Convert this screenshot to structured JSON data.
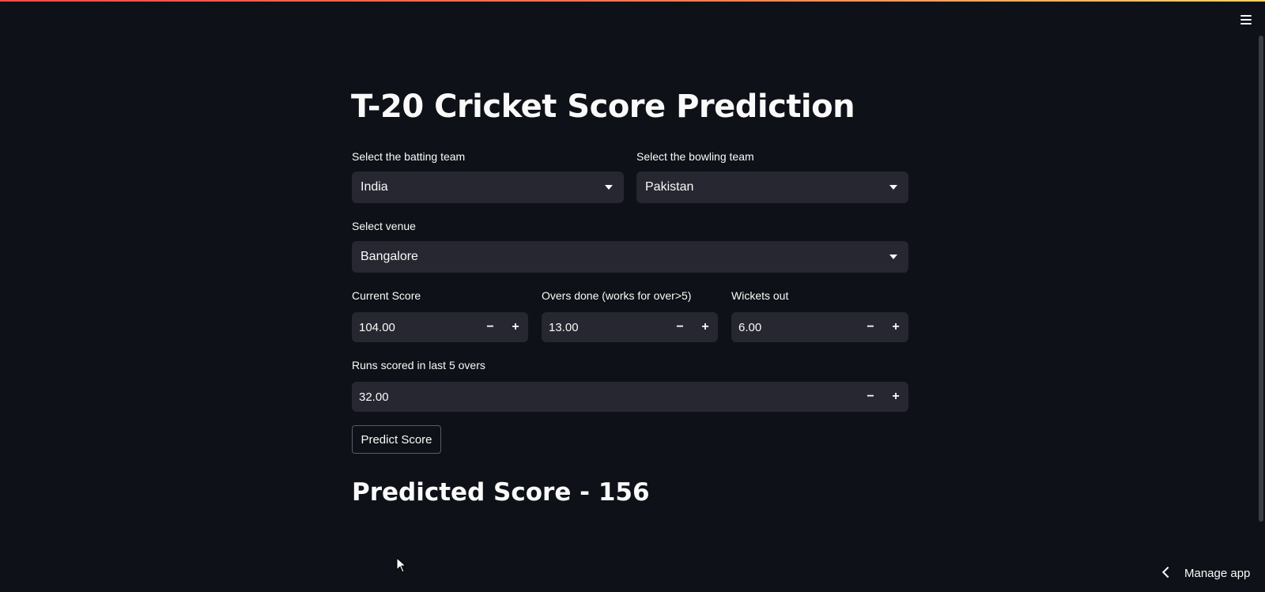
{
  "app": {
    "title": "T-20 Cricket Score Prediction",
    "menu_icon": "hamburger-menu-icon"
  },
  "form": {
    "batting": {
      "label": "Select the batting team",
      "value": "India"
    },
    "bowling": {
      "label": "Select the bowling team",
      "value": "Pakistan"
    },
    "venue": {
      "label": "Select venue",
      "value": "Bangalore"
    },
    "current_score": {
      "label": "Current Score",
      "value": "104.00"
    },
    "overs": {
      "label": "Overs done (works for over>5)",
      "value": "13.00"
    },
    "wickets": {
      "label": "Wickets out",
      "value": "6.00"
    },
    "last5": {
      "label": "Runs scored in last 5 overs",
      "value": "32.00"
    },
    "minus": "−",
    "plus": "+"
  },
  "predict_button": "Predict Score",
  "result": "Predicted Score - 156",
  "footer": {
    "manage_app": "Manage app"
  },
  "colors": {
    "background": "#0e1117",
    "widget": "#262730",
    "text": "#fafafa",
    "accent_gradient_start": "#ff4b4b",
    "accent_gradient_end": "#ffd166"
  }
}
